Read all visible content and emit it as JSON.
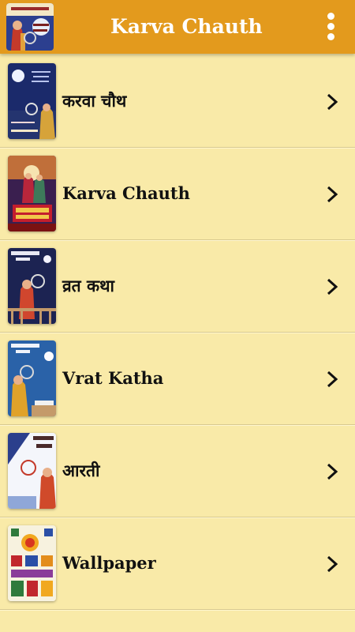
{
  "appbar": {
    "title": "Karva Chauth",
    "app_icon": "karva-chauth-app-icon",
    "menu_icon": "more-vert-icon",
    "background_color": "#e39a1d"
  },
  "list": {
    "background_color": "#f9eaa8",
    "items": [
      {
        "label": "करवा चौथ",
        "thumbnail": "moon-sieve-night-thumbnail",
        "chevron_icon": "chevron-right-icon"
      },
      {
        "label": "Karva Chauth",
        "thumbnail": "couple-happy-karva-chauth-thumbnail",
        "chevron_icon": "chevron-right-icon"
      },
      {
        "label": "व्रत कथा",
        "thumbnail": "woman-sieve-balcony-thumbnail",
        "chevron_icon": "chevron-right-icon"
      },
      {
        "label": "Vrat Katha",
        "thumbnail": "woman-sieve-moon-blue-thumbnail",
        "chevron_icon": "chevron-right-icon"
      },
      {
        "label": "आरती",
        "thumbnail": "woman-sieve-white-thumbnail",
        "chevron_icon": "chevron-right-icon"
      },
      {
        "label": "Wallpaper",
        "thumbnail": "festive-wallpaper-collage-thumbnail",
        "chevron_icon": "chevron-right-icon"
      }
    ]
  }
}
